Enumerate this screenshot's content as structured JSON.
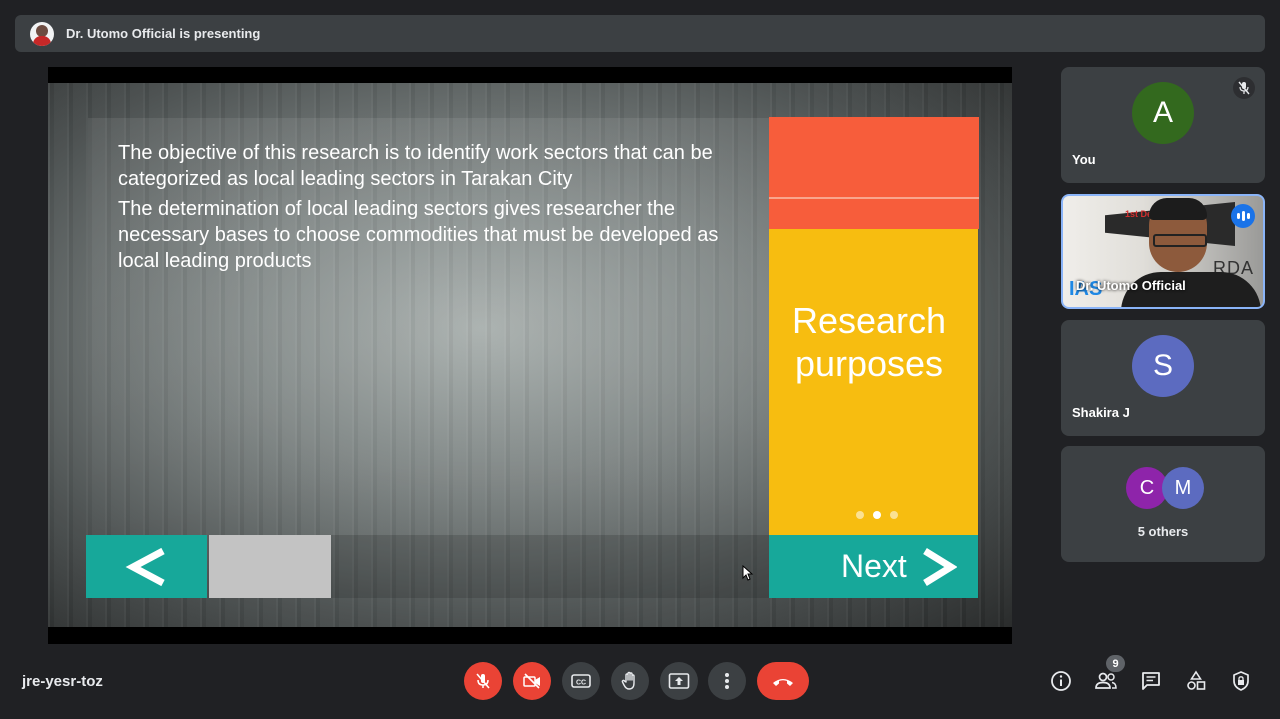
{
  "presenting_banner": {
    "text": "Dr. Utomo Official is presenting"
  },
  "slide": {
    "paragraphs": [
      "The objective of this research is to identify work sectors that can be categorized as local leading sectors in Tarakan City",
      "The determination of local leading sectors gives researcher the necessary bases to choose commodities that must be developed as local leading products"
    ],
    "side_title": "Research\npurposes",
    "next_label": "Next",
    "colors": {
      "orange": "#f75d3b",
      "yellow": "#f7bd10",
      "teal": "#17a89a"
    }
  },
  "participants": {
    "you": {
      "initial": "A",
      "name": "You",
      "color": "#33691e"
    },
    "presenter": {
      "name": "Dr. Utomo Official",
      "video_text": "1st Dec",
      "video_brand": "RDA",
      "video_brand2": "IAS"
    },
    "shakira": {
      "initial": "S",
      "name": "Shakira J",
      "color": "#5c6bc0"
    },
    "others": {
      "initials": [
        "C",
        "M"
      ],
      "colors": [
        "#8e24aa",
        "#5c6bc0"
      ],
      "label": "5 others"
    }
  },
  "bottom_bar": {
    "meeting_code": "jre-yesr-toz",
    "cc_label": "CC",
    "people_count": "9"
  }
}
